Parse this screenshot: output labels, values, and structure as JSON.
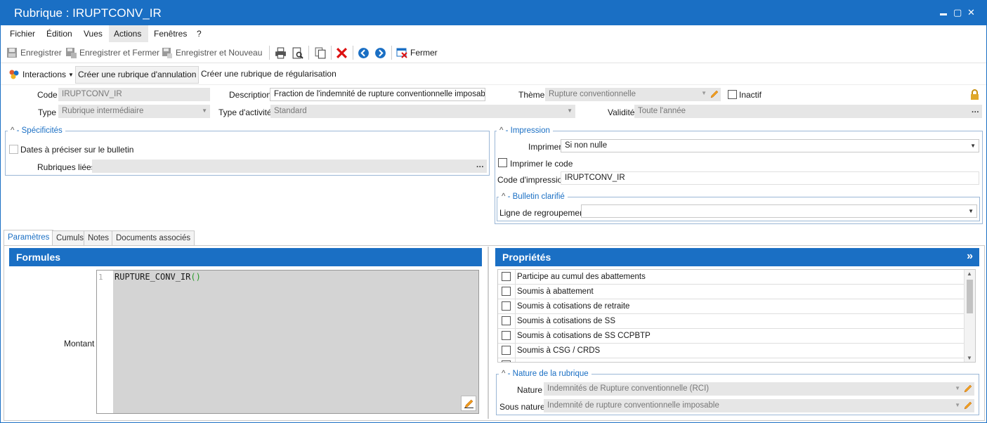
{
  "window": {
    "title": "Rubrique : IRUPTCONV_IR",
    "min": "▬",
    "max": "▫",
    "close": "✕"
  },
  "menu": [
    "Fichier",
    "Édition",
    "Vues",
    "Actions",
    "Fenêtres",
    "?"
  ],
  "toolbar": {
    "save": "Enregistrer",
    "save_close": "Enregistrer et Fermer",
    "save_new": "Enregistrer et Nouveau",
    "close": "Fermer"
  },
  "toolbar2": {
    "interactions": "Interactions",
    "cancel_rubric": "Créer une rubrique d'annulation",
    "regul_rubric": "Créer une rubrique de régularisation"
  },
  "header": {
    "code_label": "Code",
    "code_value": "IRUPTCONV_IR",
    "desc_label": "Description",
    "desc_value": "Fraction de l'indemnité de rupture conventionnelle imposable",
    "theme_label": "Thème",
    "theme_value": "Rupture conventionnelle",
    "inactive_label": "Inactif",
    "type_label": "Type",
    "type_value": "Rubrique intermédiaire",
    "activity_label": "Type d'activité",
    "activity_value": "Standard",
    "validity_label": "Validité",
    "validity_value": "Toute l'année"
  },
  "specificites": {
    "title": "Spécificités",
    "dates_label": "Dates à préciser sur le bulletin",
    "linked_label": "Rubriques liées",
    "ellipsis": "…"
  },
  "impression": {
    "title": "Impression",
    "print_label": "Imprimer",
    "print_value": "Si non nulle",
    "print_code_label": "Imprimer le code",
    "print_code_field_label": "Code d'impression",
    "print_code_value": "IRUPTCONV_IR",
    "bulletin_title": "Bulletin clarifié",
    "regroup_label": "Ligne de regroupement"
  },
  "tabs": [
    "Paramètres",
    "Cumuls",
    "Notes",
    "Documents associés"
  ],
  "formules": {
    "title": "Formules",
    "amount_label": "Montant",
    "line_no": "1",
    "code_fn": "RUPTURE_CONV_IR",
    "code_parens": "()"
  },
  "proprietes": {
    "title": "Propriétés",
    "expand": "»",
    "items": [
      "Participe au cumul des abattements",
      "Soumis à abattement",
      "Soumis à cotisations de retraite",
      "Soumis à cotisations de SS",
      "Soumis à cotisations de SS CCPBTP",
      "Soumis à CSG / CRDS"
    ],
    "nature_title": "Nature de la rubrique",
    "nature_label": "Nature",
    "nature_value": "Indemnités de Rupture conventionnelle (RCI)",
    "subnature_label": "Sous nature",
    "subnature_value": "Indemnité de rupture conventionnelle imposable"
  },
  "colors": {
    "accent": "#1a6fc4"
  }
}
